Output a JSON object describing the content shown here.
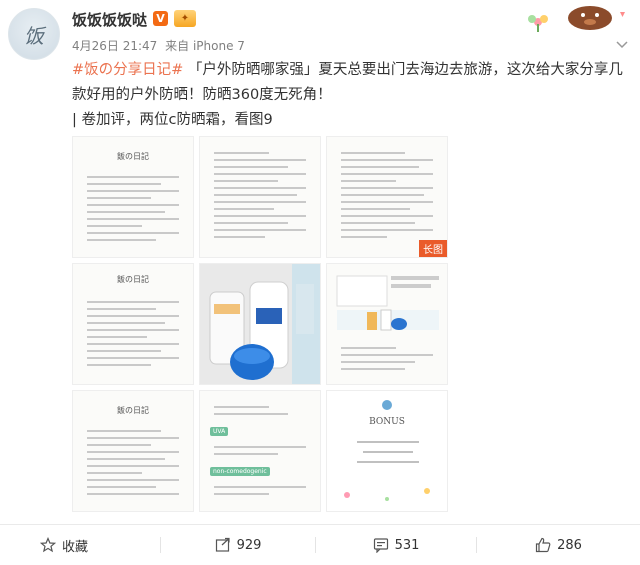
{
  "post": {
    "author": "饭饭饭饭哒",
    "vip_badge": "V",
    "avatar_text": "饭",
    "date": "4月26日 21:47",
    "source": "来自 iPhone 7",
    "hashtag": "#饭の分享日记#",
    "body_1": " 「户外防晒哪家强」夏天总要出门去海边去旅游，这次给大家分享几款好用的户外防晒！防晒360度无死角！",
    "body_2": "| 卷加评，两位c防晒霜，看图9",
    "long_image_label": "长图",
    "sticker_text": "BONUS"
  },
  "actions": {
    "favorite_label": "收藏",
    "repost_count": "929",
    "comment_count": "531",
    "like_count": "286"
  },
  "colors": {
    "hashtag": "#eb7350",
    "vip": "#f36a14"
  }
}
